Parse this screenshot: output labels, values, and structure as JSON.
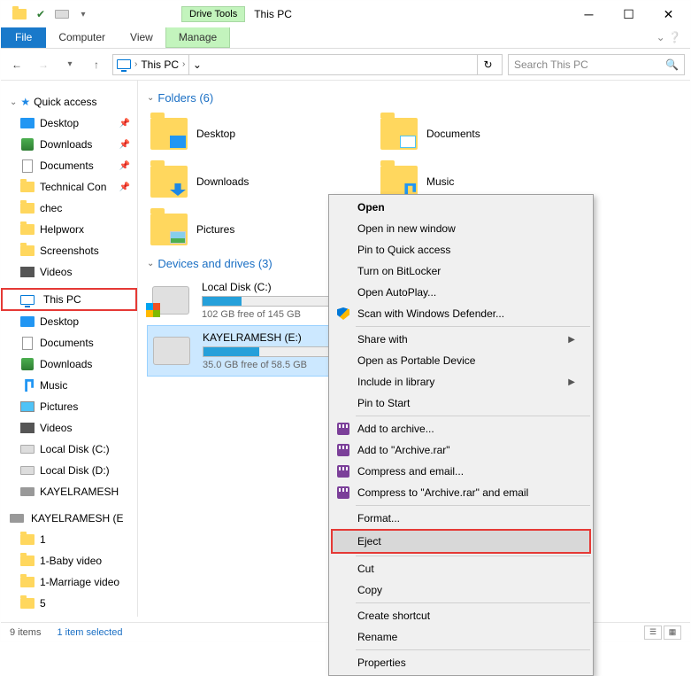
{
  "window": {
    "title": "This PC",
    "drive_tools": "Drive Tools",
    "manage": "Manage"
  },
  "tabs": {
    "file": "File",
    "computer": "Computer",
    "view": "View"
  },
  "address": {
    "location": "This PC",
    "sep": "›"
  },
  "search": {
    "placeholder": "Search This PC"
  },
  "sidebar": {
    "quick_access": "Quick access",
    "items_pinned": [
      {
        "label": "Desktop",
        "pin": true
      },
      {
        "label": "Downloads",
        "pin": true
      },
      {
        "label": "Documents",
        "pin": true
      },
      {
        "label": "Technical Con",
        "pin": true
      },
      {
        "label": "chec",
        "pin": false
      },
      {
        "label": "Helpworx",
        "pin": false
      },
      {
        "label": "Screenshots",
        "pin": false
      },
      {
        "label": "Videos",
        "pin": false
      }
    ],
    "this_pc": "This PC",
    "pc_items": [
      {
        "label": "Desktop"
      },
      {
        "label": "Documents"
      },
      {
        "label": "Downloads"
      },
      {
        "label": "Music"
      },
      {
        "label": "Pictures"
      },
      {
        "label": "Videos"
      },
      {
        "label": "Local Disk (C:)"
      },
      {
        "label": "Local Disk (D:)"
      },
      {
        "label": "KAYELRAMESH"
      }
    ],
    "ext_drive": "KAYELRAMESH (E",
    "ext_items": [
      "1",
      "1-Baby video",
      "1-Marriage video",
      "5"
    ]
  },
  "main": {
    "folders_hdr": "Folders (6)",
    "folders": [
      "Desktop",
      "Documents",
      "Downloads",
      "Music",
      "Pictures"
    ],
    "drives_hdr": "Devices and drives (3)",
    "drives": [
      {
        "name": "Local Disk (C:)",
        "free": "102 GB free of 145 GB",
        "fill": 28
      },
      {
        "name": "KAYELRAMESH (E:)",
        "free": "35.0 GB free of 58.5 GB",
        "fill": 40
      }
    ]
  },
  "menu": {
    "open": "Open",
    "open_new": "Open in new window",
    "pin_qa": "Pin to Quick access",
    "bitlocker": "Turn on BitLocker",
    "autoplay": "Open AutoPlay...",
    "defender": "Scan with Windows Defender...",
    "share": "Share with",
    "portable": "Open as Portable Device",
    "library": "Include in library",
    "pin_start": "Pin to Start",
    "archive": "Add to archive...",
    "archive_rar": "Add to \"Archive.rar\"",
    "compress_email": "Compress and email...",
    "compress_rar_email": "Compress to \"Archive.rar\" and email",
    "format": "Format...",
    "eject": "Eject",
    "cut": "Cut",
    "copy": "Copy",
    "shortcut": "Create shortcut",
    "rename": "Rename",
    "properties": "Properties"
  },
  "status": {
    "items": "9 items",
    "selected": "1 item selected"
  }
}
